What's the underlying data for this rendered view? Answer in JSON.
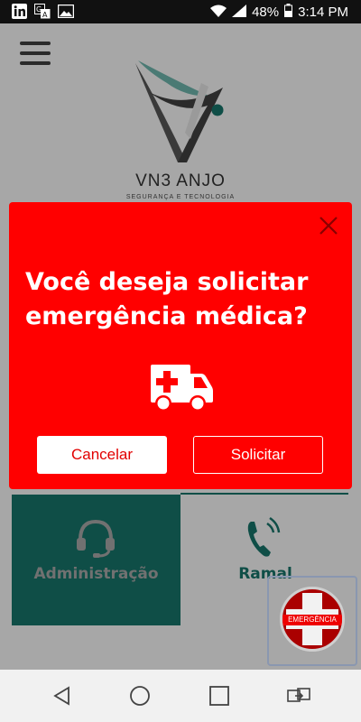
{
  "status_bar": {
    "battery": "48%",
    "time": "3:14 PM",
    "icons": [
      "linkedin-icon",
      "translate-icon",
      "image-icon",
      "wifi-icon",
      "signal-icon",
      "battery-icon"
    ]
  },
  "header": {
    "logo_name": "VN3 ANJO",
    "logo_tagline": "SEGURANÇA E TECNOLOGIA"
  },
  "tiles": [
    {
      "label": "Administração",
      "icon": "headset-icon"
    },
    {
      "label": "Ramal",
      "icon": "phone-ringing-icon"
    }
  ],
  "fab": {
    "label": "EMERGÊNCIA"
  },
  "dialog": {
    "message": "Você deseja solicitar emergência médica?",
    "icon": "ambulance-icon",
    "cancel_label": "Cancelar",
    "confirm_label": "Solicitar"
  },
  "colors": {
    "dialog_bg": "#ff0000",
    "teal": "#0f4e47",
    "scrim": "#a7a7a7"
  },
  "nav_bar": {
    "buttons": [
      "back-icon",
      "home-icon",
      "recents-icon",
      "switch-app-icon"
    ]
  }
}
